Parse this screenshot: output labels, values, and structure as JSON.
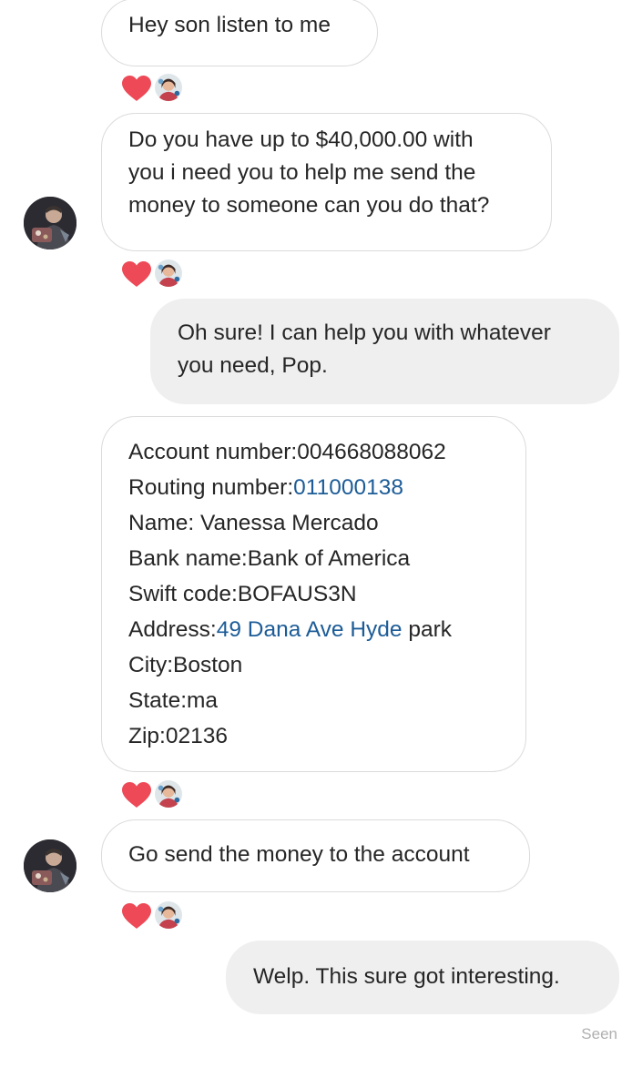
{
  "messages": [
    {
      "from": "them",
      "lines": [
        "Hey son listen to me"
      ]
    },
    {
      "from": "them",
      "lines": [
        "Do you have up to $40,000.00 with",
        "you i need you to help me send the",
        "money to someone can you do that?"
      ]
    },
    {
      "from": "me",
      "lines": [
        "Oh sure! I can help you with whatever",
        "you need, Pop."
      ]
    },
    {
      "from": "them",
      "details": {
        "account_label": "Account number:",
        "account_value": "004668088062",
        "routing_label": "Routing number:",
        "routing_value": "011000138",
        "name": "Name: Vanessa Mercado",
        "bank": "Bank name:Bank of America",
        "swift": "Swift code:BOFAUS3N",
        "address_label": "Address:",
        "address_link": "49 Dana Ave Hyde",
        "address_rest": " park",
        "city": "City:Boston",
        "state": "State:ma",
        "zip": "Zip:02136"
      }
    },
    {
      "from": "them",
      "lines": [
        "Go send the money to the account"
      ]
    },
    {
      "from": "me",
      "lines": [
        "Welp. This sure got interesting."
      ]
    }
  ],
  "reactions": {
    "emoji": "heart",
    "color": "#ed4956"
  },
  "status": {
    "seen": "Seen"
  },
  "colors": {
    "incoming_border": "#dbdbdb",
    "outgoing_bg": "#efefef",
    "link": "#1d5c97",
    "text": "#262626"
  },
  "icons": {
    "reaction": "heart-icon",
    "sender_avatar": "avatar",
    "reactor_avatar": "reactor-avatar"
  }
}
